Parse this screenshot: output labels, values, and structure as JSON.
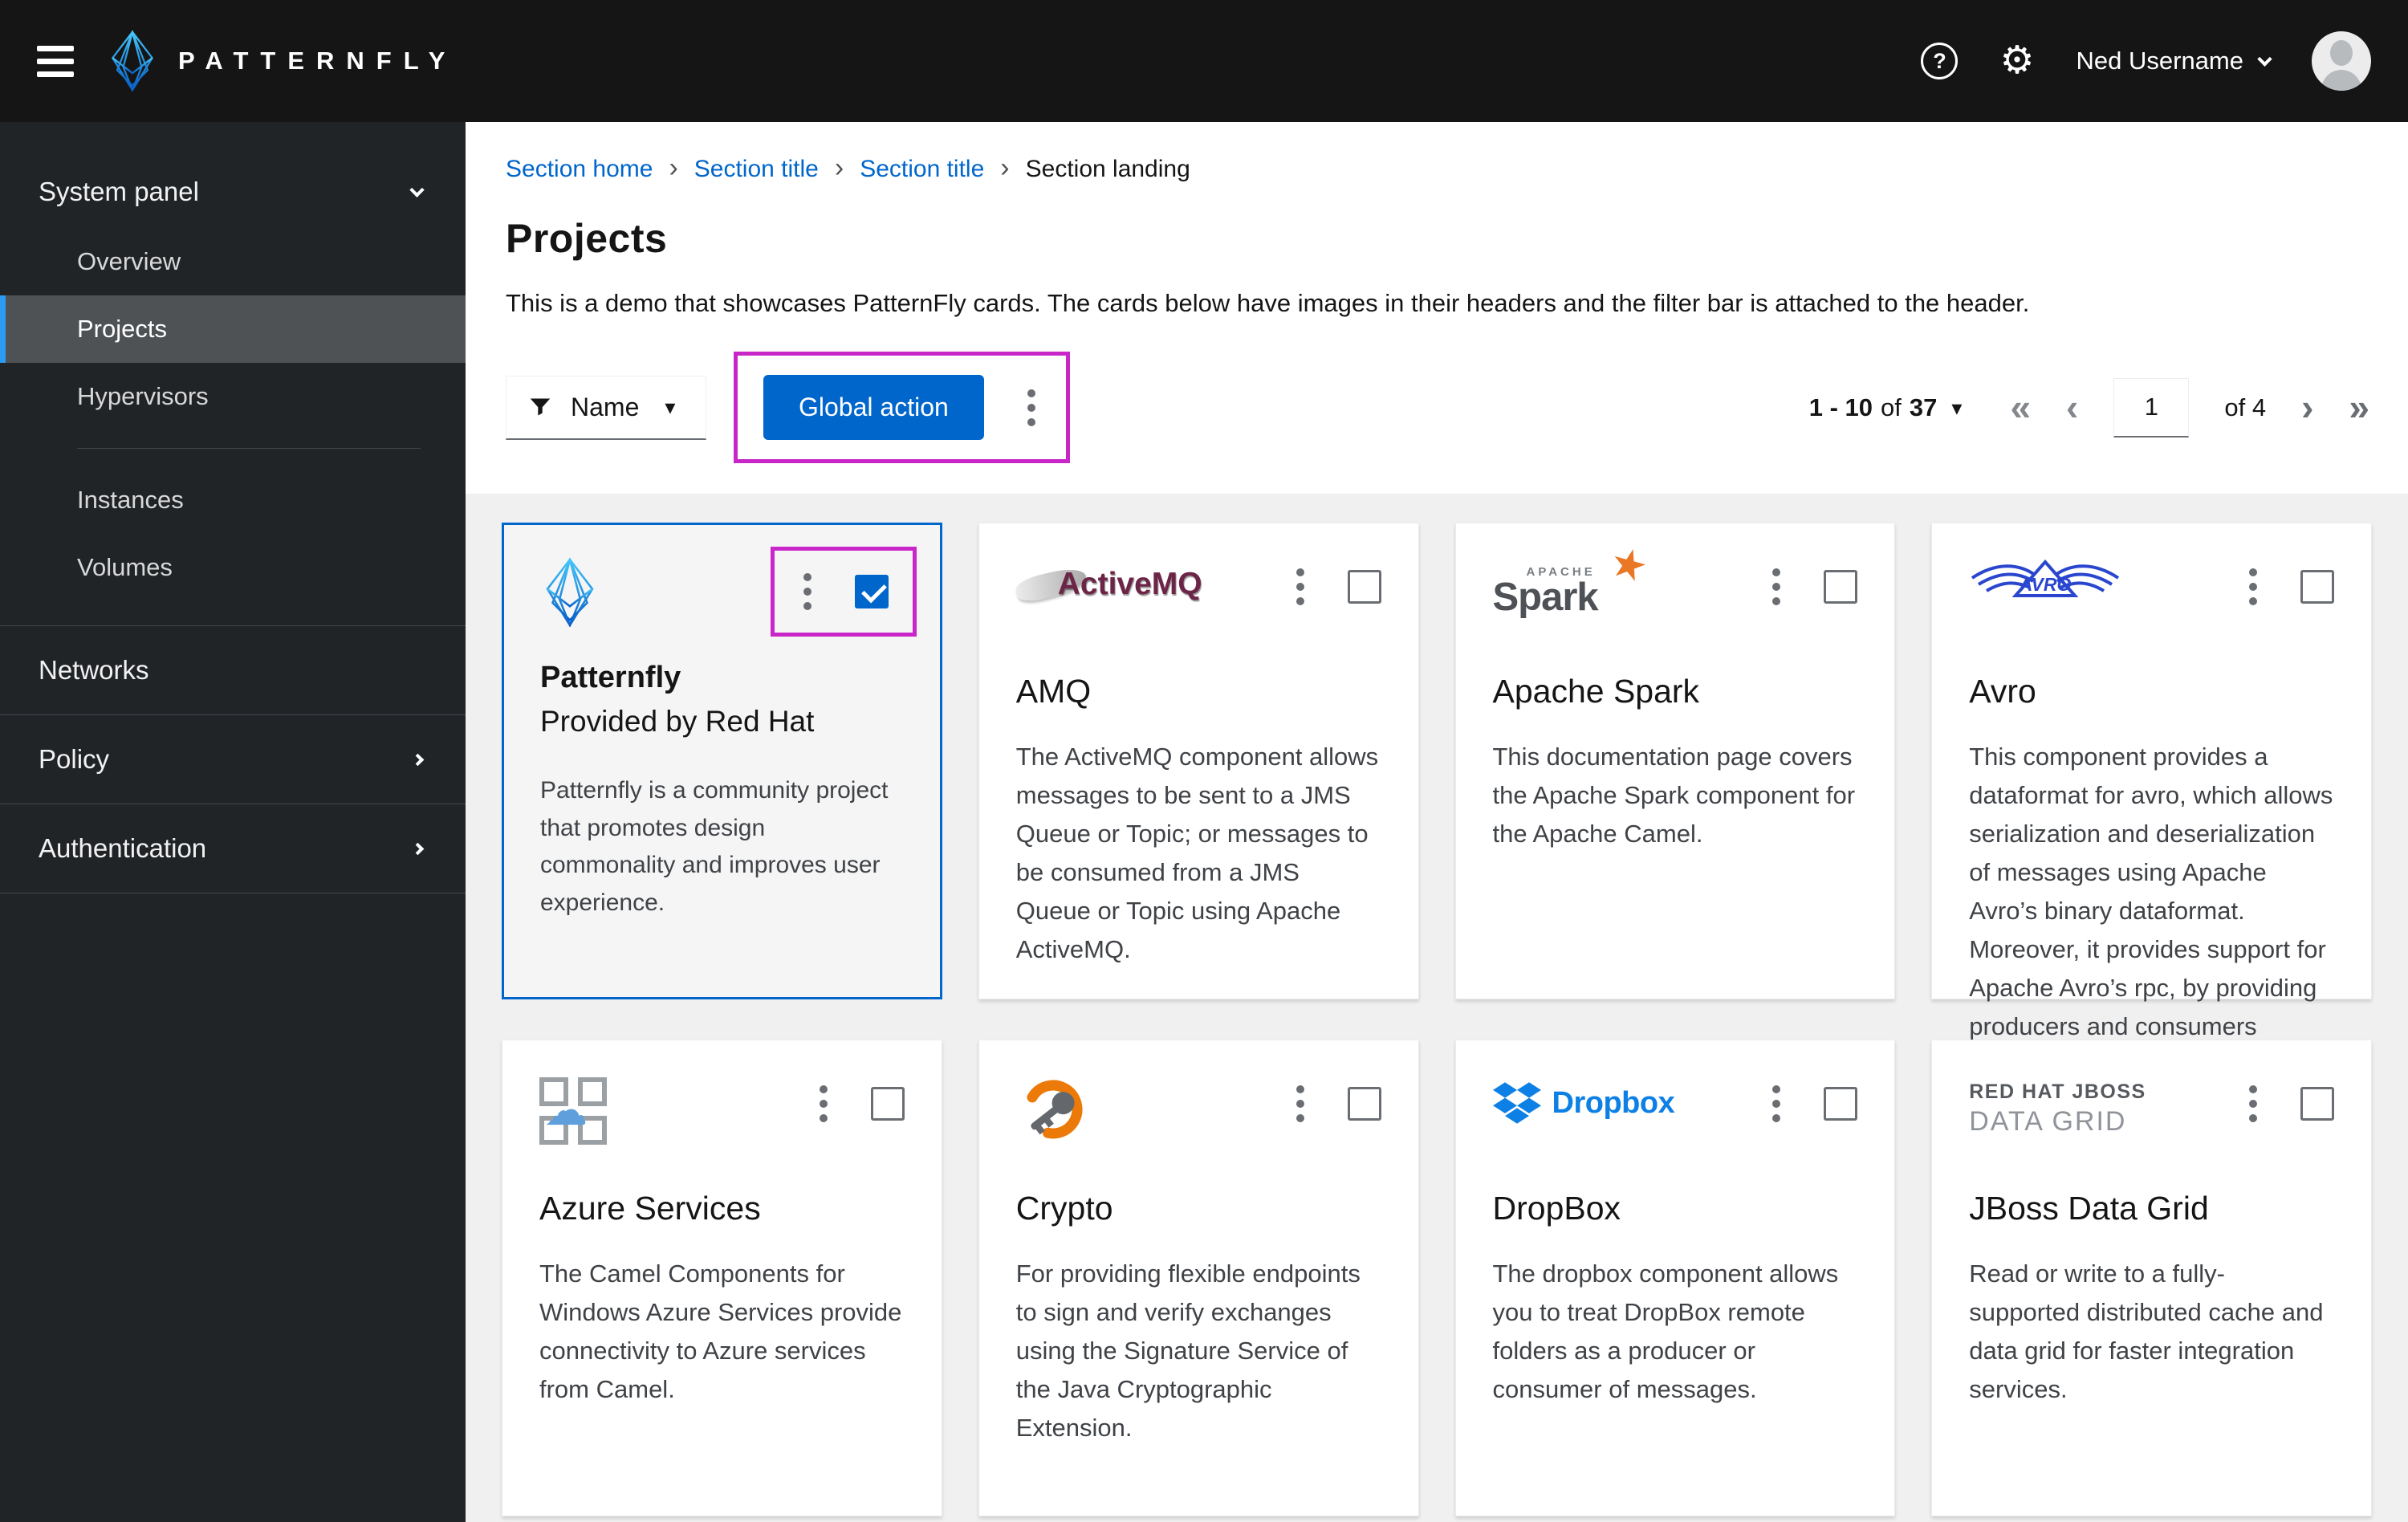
{
  "colors": {
    "masthead_bg": "#151515",
    "sidebar_bg": "#212427",
    "content_bg": "#f0f0f0",
    "accent": "#0066cc",
    "link": "#0066cc",
    "nav_current_indicator": "#2b9af3",
    "annotation": "#c926c9"
  },
  "masthead": {
    "brand": "PATTERNFLY",
    "brand_logo_icon": "patternfly-diamond-logo",
    "menu_icon": "hamburger-menu-icon",
    "help_icon": "question-circle-icon",
    "help_glyph": "?",
    "settings_icon": "gear-icon",
    "settings_glyph": "⚙",
    "user_name": "Ned Username",
    "avatar_icon": "user-avatar"
  },
  "sidebar": {
    "group": {
      "title": "System panel",
      "items": [
        {
          "label": "Overview"
        },
        {
          "label": "Projects",
          "current": true
        },
        {
          "label": "Hypervisors"
        },
        {
          "label": "Instances"
        },
        {
          "label": "Volumes"
        }
      ]
    },
    "items": [
      {
        "label": "Networks"
      },
      {
        "label": "Policy"
      },
      {
        "label": "Authentication"
      }
    ]
  },
  "breadcrumb": {
    "separator": "›",
    "items": [
      {
        "label": "Section home"
      },
      {
        "label": "Section title"
      },
      {
        "label": "Section title"
      },
      {
        "label": "Section landing"
      }
    ]
  },
  "page": {
    "title": "Projects",
    "description": "This is a demo that showcases PatternFly cards. The cards below have images in their headers and the filter bar is attached to the header."
  },
  "toolbar": {
    "filter": {
      "icon": "filter-funnel-icon",
      "label": "Name",
      "caret": "▾"
    },
    "global_action_label": "Global action",
    "kebab_icon": "kebab-menu-icon"
  },
  "pagination": {
    "range": "1 - 10",
    "of_label": "of",
    "total": "37",
    "caret": "▾",
    "first_glyph": "«",
    "prev_glyph": "‹",
    "page_input": "1",
    "pages_label": "of 4",
    "next_glyph": "›",
    "last_glyph": "»"
  },
  "cards": [
    {
      "logo": "patternfly-diamond-logo",
      "title": "Patternfly",
      "subtitle": "Provided by Red Hat",
      "description": "Patternfly is a community project that promotes design commonality and improves user experience.",
      "checked": true,
      "annotated": true
    },
    {
      "logo": "activemq-logo",
      "logo_text": "ActiveMQ",
      "title": "AMQ",
      "description": "The ActiveMQ component allows messages to be sent to a JMS Queue or Topic; or messages to be consumed from a JMS Queue or Topic using Apache ActiveMQ.",
      "checked": false
    },
    {
      "logo": "apache-spark-logo",
      "logo_text_top": "APACHE",
      "logo_text": "Spark",
      "logo_star": "★",
      "title": "Apache Spark",
      "description": "This documentation page covers the Apache Spark component for the Apache Camel.",
      "checked": false
    },
    {
      "logo": "avro-logo",
      "logo_text": "AVRO",
      "title": "Avro",
      "description": "This component provides a dataformat for avro, which allows serialization and deserialization of messages using Apache Avro’s binary dataformat. Moreover, it provides support for Apache Avro’s rpc, by providing producers and consumers endpoint for using avro over netty or http.",
      "checked": false
    },
    {
      "logo": "azure-services-logo",
      "logo_cloud": "☁",
      "title": "Azure Services",
      "description": "The Camel Components for Windows Azure Services provide connectivity to Azure services from Camel.",
      "checked": false
    },
    {
      "logo": "crypto-key-logo",
      "title": "Crypto",
      "description": "For providing flexible endpoints to sign and verify exchanges using the Signature Service of the Java Cryptographic Extension.",
      "checked": false
    },
    {
      "logo": "dropbox-logo",
      "logo_text": "Dropbox",
      "title": "DropBox",
      "description": "The dropbox component allows you to treat DropBox remote folders as a producer or consumer of messages.",
      "checked": false
    },
    {
      "logo": "jboss-data-grid-logo",
      "logo_text": "RED HAT JBOSS",
      "logo_text2": "DATA GRID",
      "title": "JBoss Data Grid",
      "description": "Read or write to a fully-supported distributed cache and data grid for faster integration services.",
      "checked": false
    }
  ]
}
